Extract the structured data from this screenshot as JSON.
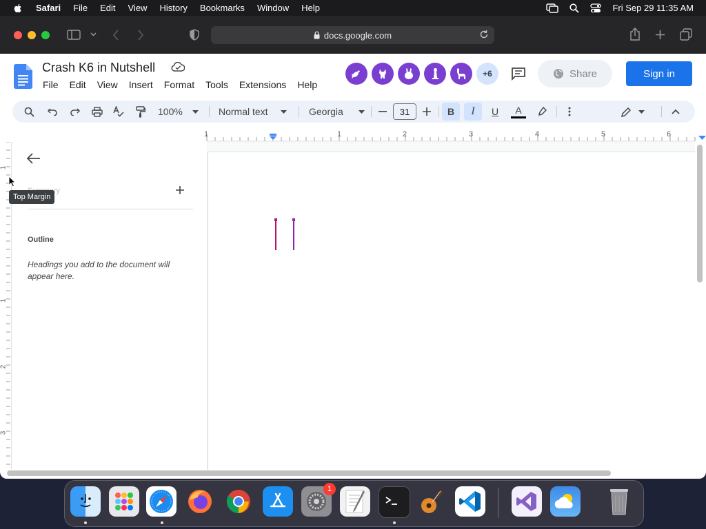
{
  "menubar": {
    "app_name": "Safari",
    "items": [
      "File",
      "Edit",
      "View",
      "History",
      "Bookmarks",
      "Window",
      "Help"
    ],
    "clock": "Fri Sep 29  11:35 AM"
  },
  "safari": {
    "url": "docs.google.com"
  },
  "docs": {
    "title": "Crash K6 in Nutshell",
    "menus": [
      "File",
      "Edit",
      "View",
      "Insert",
      "Format",
      "Tools",
      "Extensions",
      "Help"
    ],
    "collaborators_more": "+6",
    "share_label": "Share",
    "signin_label": "Sign in",
    "accent": "#1a73e8"
  },
  "toolbar": {
    "zoom": "100%",
    "style": "Normal text",
    "font": "Georgia",
    "font_size": "31",
    "bold": "B",
    "italic": "I",
    "underline": "U",
    "text_color": "A"
  },
  "ruler": {
    "marks": [
      "1",
      "1",
      "2",
      "3",
      "4",
      "5",
      "6"
    ],
    "vertical_marks": [
      "1",
      "1",
      "2",
      "3"
    ]
  },
  "sidebar": {
    "summary_label": "Summary",
    "outline_label": "Outline",
    "outline_hint": "Headings you add to the document will appear here."
  },
  "tooltip": {
    "text": "Top Margin"
  },
  "dock": {
    "apps": [
      "finder",
      "launchpad",
      "safari",
      "firefox",
      "chrome",
      "app-store",
      "system-settings",
      "textedit",
      "terminal",
      "garageband",
      "vscode",
      "visual-studio",
      "weather",
      "trash"
    ],
    "settings_badge": "1"
  }
}
